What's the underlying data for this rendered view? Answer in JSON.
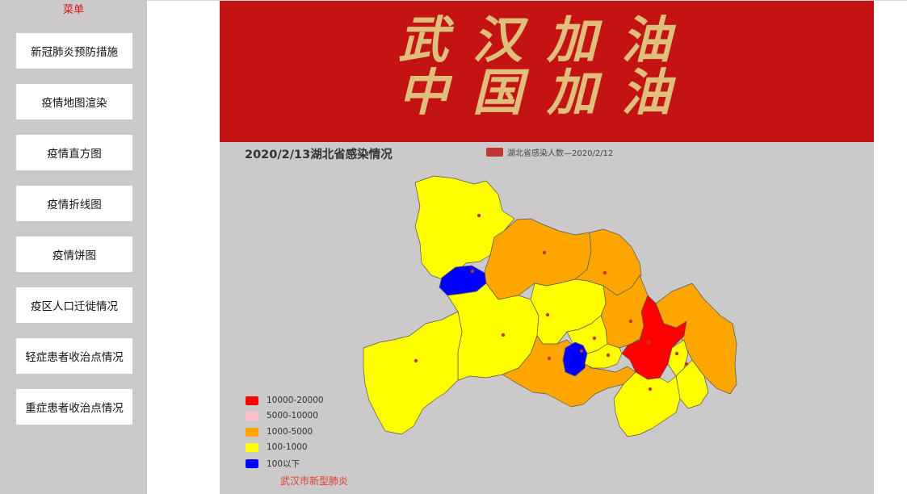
{
  "sidebar": {
    "title": "菜单",
    "items": [
      {
        "label": "新冠肺炎预防措施"
      },
      {
        "label": "疫情地图渲染"
      },
      {
        "label": "疫情直方图"
      },
      {
        "label": "疫情折线图"
      },
      {
        "label": "疫情饼图"
      },
      {
        "label": "疫区人口迁徙情况"
      },
      {
        "label": "轻症患者收治点情况"
      },
      {
        "label": "重症患者收治点情况"
      }
    ]
  },
  "banner": {
    "line1": "武汉加油",
    "line2": "中国加油",
    "background": "#c31413",
    "text_color": "#e0bf7c"
  },
  "map": {
    "title": "2020/2/13湖北省感染情况",
    "series_legend": "湖北省感染人数—2020/2/12",
    "legend": [
      {
        "label": "10000-20000",
        "color": "#ff0000"
      },
      {
        "label": "5000-10000",
        "color": "#ffc0cb"
      },
      {
        "label": "1000-5000",
        "color": "#ffa500"
      },
      {
        "label": "100-1000",
        "color": "#ffff00"
      },
      {
        "label": "100以下",
        "color": "#0000ff"
      }
    ]
  },
  "footer": {
    "link": "武汉市新型肺炎"
  }
}
